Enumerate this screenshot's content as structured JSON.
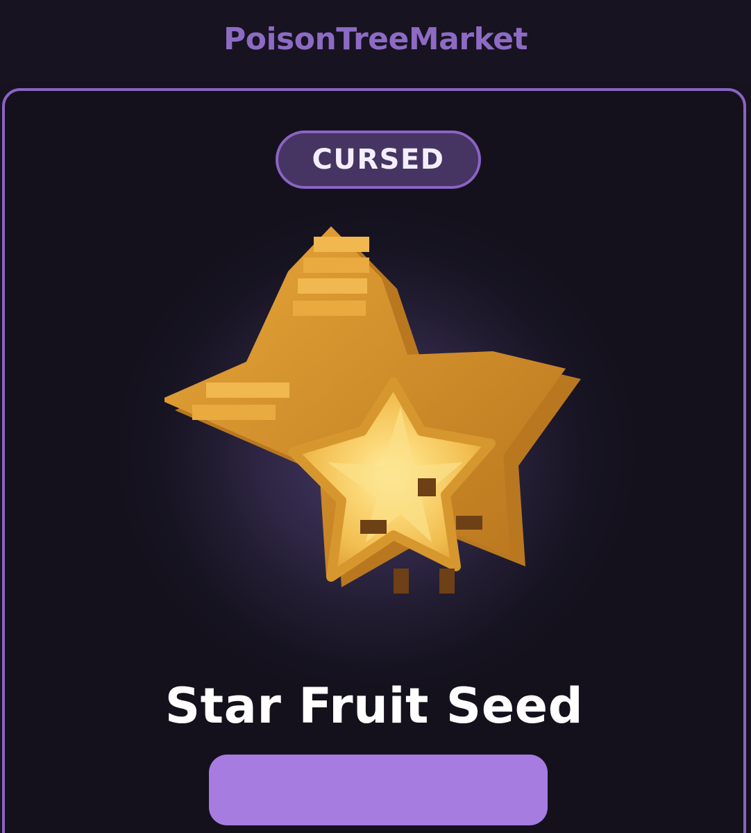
{
  "header": {
    "brand": "PoisonTreeMarket",
    "brand_color": "#8d6bc4"
  },
  "card": {
    "badge_label": "CURSED",
    "item_icon": "star-fruit-seed-icon",
    "item_name": "Star Fruit Seed",
    "action_button_label": "",
    "accent_color": "#8a64c2",
    "button_color": "#a77ce0"
  }
}
